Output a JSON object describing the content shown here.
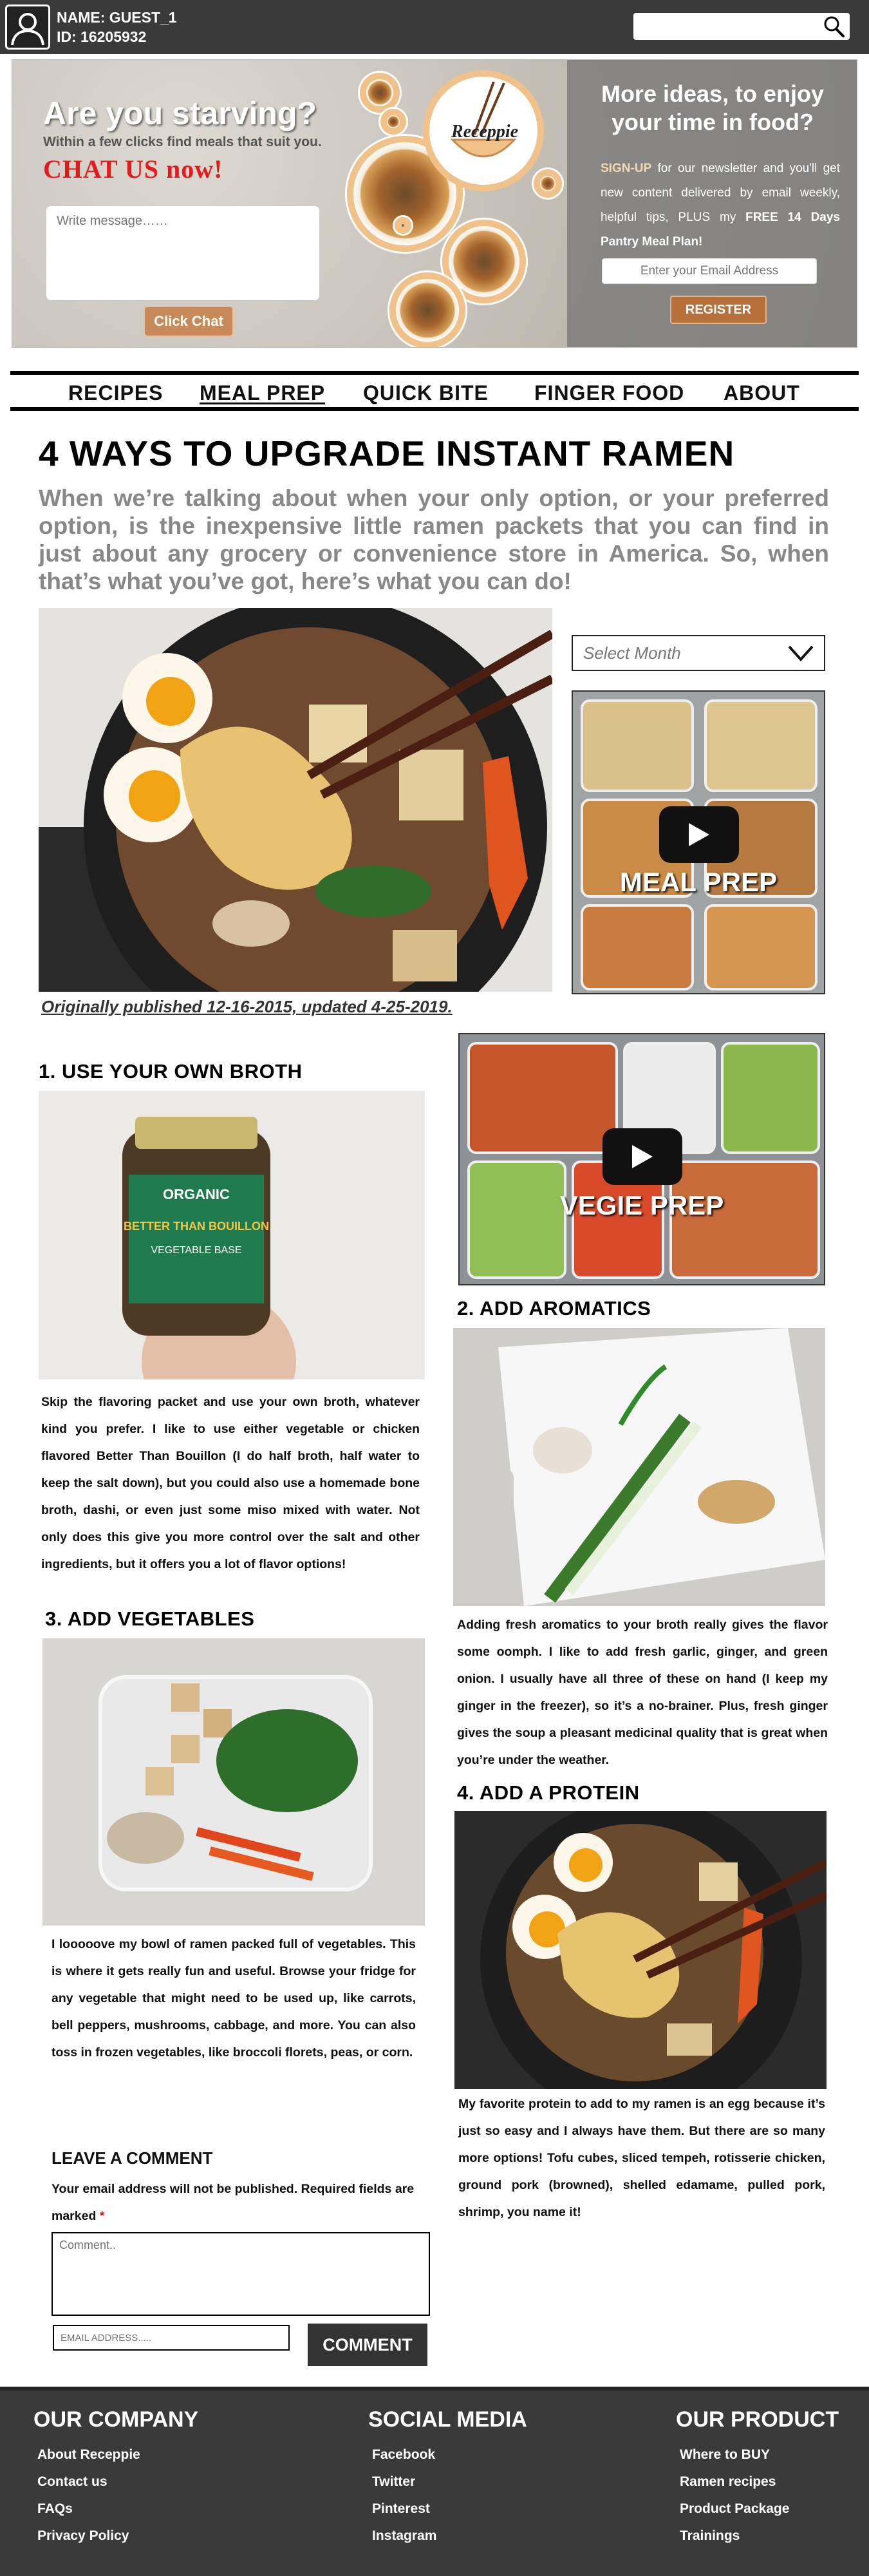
{
  "user": {
    "name": "NAME: GUEST_1",
    "id": "ID: 16205932"
  },
  "search": {
    "placeholder": ""
  },
  "hero": {
    "title": "Are you starving?",
    "subtitle": "Within a few clicks find meals that suit you.",
    "chat_cta": "CHAT US now!",
    "message_placeholder": "Write message……",
    "chat_button": "Click Chat",
    "logo_text": "Receppie"
  },
  "newsletter": {
    "title_line1": "More ideas, to enjoy",
    "title_line2": "your time in food?",
    "signup": "SIGN-UP",
    "body": " for our newsletter and you'll get new content delivered by email weekly, helpful tips, PLUS my ",
    "offer": "FREE 14 Days Pantry Meal Plan!",
    "email_placeholder": "Enter your Email Address",
    "register_button": "REGISTER"
  },
  "nav": {
    "items": [
      "RECIPES",
      "MEAL PREP",
      "QUICK BITE",
      "FINGER FOOD",
      "ABOUT"
    ],
    "active": "MEAL PREP"
  },
  "article": {
    "title": "4 WAYS TO UPGRADE INSTANT RAMEN",
    "intro": "When we’re talking about when your only option, or your preferred option, is the inexpensive little ramen packets that you can find in just about any grocery or convenience store in America. So, when that’s what you’ve got, here’s what you can do!",
    "published": "Originally published 12-16-2015, updated 4-25-2019."
  },
  "sidebar": {
    "month_select": "Select Month",
    "video1_caption": "MEAL PREP",
    "video2_caption": "VEGIE PREP"
  },
  "sections": {
    "broth": {
      "heading": "1. USE YOUR OWN BROTH",
      "body": "Skip the flavoring packet and use your own broth, whatever kind you prefer. I like to use either vegetable or chicken flavored Better Than Bouillon (I do half broth, half water to keep the salt down), but you could also use a homemade bone broth, dashi, or even just some miso mixed with water. Not only does this give you more control over the salt and other ingredients, but it offers you a lot of flavor options!",
      "jar_label_top": "ORGANIC",
      "jar_label_brand": "BETTER THAN BOUILLON",
      "jar_label_type": "VEGETABLE BASE"
    },
    "aromatics": {
      "heading": "2. ADD AROMATICS",
      "body": "Adding fresh aromatics to your broth really gives the flavor some oomph. I like to add fresh garlic, ginger, and green onion. I usually have all three of these on hand (I keep my ginger in the freezer), so it’s a no-brainer. Plus, fresh ginger gives the soup a pleasant medicinal quality that is great when you’re under the weather."
    },
    "vegetables": {
      "heading": "3. ADD VEGETABLES",
      "body": "I looooove my bowl of ramen packed full of vegetables. This is where it gets really fun and useful. Browse your fridge for any vegetable that might need to be used up, like carrots, bell peppers, mushrooms, cabbage, and more. You can also toss in frozen vegetables, like broccoli florets, peas, or corn."
    },
    "protein": {
      "heading": "4. ADD A PROTEIN",
      "body": "My favorite protein to add to my ramen is an egg because it’s just so easy and I always have them. But there are so many more options! Tofu cubes, sliced tempeh, rotisserie chicken, ground pork (browned), shelled edamame, pulled pork, shrimp, you name it!"
    }
  },
  "comment": {
    "heading": "LEAVE A COMMENT",
    "note": "Your email address will not be published. Required fields are marked ",
    "required_mark": "*",
    "comment_placeholder": "Comment..",
    "email_placeholder": "EMAIL ADDRESS.....",
    "submit": "COMMENT"
  },
  "footer": {
    "company": {
      "title": "OUR COMPANY",
      "links": [
        "About Receppie",
        "Contact us",
        "FAQs",
        "Privacy Policy"
      ]
    },
    "social": {
      "title": "SOCIAL MEDIA",
      "links": [
        "Facebook",
        "Twitter",
        "Pinterest",
        "Instagram"
      ]
    },
    "product": {
      "title": "OUR PRODUCT",
      "links": [
        "Where to BUY",
        "Ramen recipes",
        "Product Package",
        "Trainings"
      ]
    }
  },
  "colors": {
    "topbar": "#3a3a3a",
    "accent_red": "#e41b1b",
    "button_brown": "#b8703b",
    "footer": "#3a3a3a"
  },
  "icons": {
    "avatar": "user-avatar-icon",
    "search": "search-icon",
    "play": "play-icon",
    "select": "chevron-down-icon"
  }
}
